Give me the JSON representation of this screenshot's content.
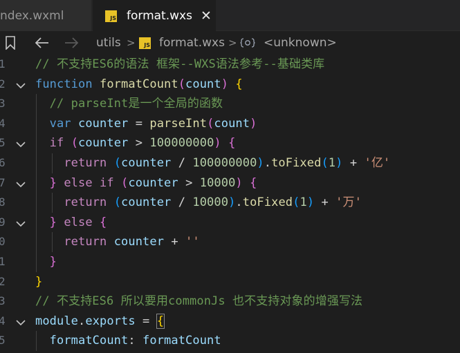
{
  "tabs": {
    "inactive_label": "ndex.wxml",
    "active_label": "format.wxs",
    "active_icon_text": "JS",
    "close_glyph": "✕"
  },
  "breadcrumb": {
    "folder": "utils",
    "separator": ">",
    "file_icon_text": "JS",
    "file": "format.wxs",
    "symbol": "<unknown>"
  },
  "icons": {
    "bookmark": "bookmark-icon",
    "back": "arrow-left-icon",
    "forward": "arrow-right-icon",
    "fold": "chevron-down-icon",
    "symbol": "symbol-namespace-icon"
  },
  "gutter": [
    "1",
    "2",
    "3",
    "4",
    "5",
    "6",
    "7",
    "8",
    "9",
    "0",
    "1",
    "2",
    "3",
    "4",
    "5"
  ],
  "code": [
    [
      [
        "// 不支持ES6的语法 框架--WXS语法参考--基础类库",
        "c-comment"
      ]
    ],
    [
      [
        "function ",
        "c-decl"
      ],
      [
        "formatCount",
        "c-fn"
      ],
      [
        "(",
        "c-br2"
      ],
      [
        "count",
        "c-var"
      ],
      [
        "(",
        "c-br2"
      ],
      [
        ") ",
        "c-br2"
      ],
      [
        "{",
        "c-br1"
      ]
    ],
    [
      [
        "  // parseInt是一个全局的函数",
        "c-comment"
      ]
    ],
    [
      [
        "  var ",
        "c-decl"
      ],
      [
        "counter ",
        "c-var"
      ],
      [
        "= ",
        "c-plain"
      ],
      [
        "parseInt",
        "c-fn"
      ],
      [
        "(",
        "c-br2"
      ],
      [
        "count",
        "c-var"
      ],
      [
        ")",
        "c-br2"
      ]
    ],
    [
      [
        "  if ",
        "c-kw"
      ],
      [
        "(",
        "c-br2"
      ],
      [
        "counter ",
        "c-var"
      ],
      [
        "> ",
        "c-plain"
      ],
      [
        "100000000",
        "c-num"
      ],
      [
        ") ",
        "c-br2"
      ],
      [
        "{",
        "c-br2"
      ]
    ],
    [
      [
        "    return ",
        "c-kw"
      ],
      [
        "(",
        "c-br3"
      ],
      [
        "counter ",
        "c-var"
      ],
      [
        "/ ",
        "c-plain"
      ],
      [
        "100000000",
        "c-num"
      ],
      [
        ")",
        "c-br3"
      ],
      [
        ".",
        "c-plain"
      ],
      [
        "toFixed",
        "c-fn"
      ],
      [
        "(",
        "c-br3"
      ],
      [
        "1",
        "c-num"
      ],
      [
        ")",
        "c-br3"
      ],
      [
        " + ",
        "c-plain"
      ],
      [
        "'亿'",
        "c-str"
      ]
    ],
    [
      [
        "  ",
        "c-plain"
      ],
      [
        "}",
        "c-br2"
      ],
      [
        " else if ",
        "c-kw"
      ],
      [
        "(",
        "c-br2"
      ],
      [
        "counter ",
        "c-var"
      ],
      [
        "> ",
        "c-plain"
      ],
      [
        "10000",
        "c-num"
      ],
      [
        ") ",
        "c-br2"
      ],
      [
        "{",
        "c-br2"
      ]
    ],
    [
      [
        "    return ",
        "c-kw"
      ],
      [
        "(",
        "c-br3"
      ],
      [
        "counter ",
        "c-var"
      ],
      [
        "/ ",
        "c-plain"
      ],
      [
        "10000",
        "c-num"
      ],
      [
        ")",
        "c-br3"
      ],
      [
        ".",
        "c-plain"
      ],
      [
        "toFixed",
        "c-fn"
      ],
      [
        "(",
        "c-br3"
      ],
      [
        "1",
        "c-num"
      ],
      [
        ")",
        "c-br3"
      ],
      [
        " + ",
        "c-plain"
      ],
      [
        "'万'",
        "c-str"
      ]
    ],
    [
      [
        "  ",
        "c-plain"
      ],
      [
        "}",
        "c-br2"
      ],
      [
        " else ",
        "c-kw"
      ],
      [
        "{",
        "c-br2"
      ]
    ],
    [
      [
        "    return ",
        "c-kw"
      ],
      [
        "counter ",
        "c-var"
      ],
      [
        "+ ",
        "c-plain"
      ],
      [
        "''",
        "c-str"
      ]
    ],
    [
      [
        "  ",
        "c-plain"
      ],
      [
        "}",
        "c-br2"
      ]
    ],
    [
      [
        "}",
        "c-br1"
      ]
    ],
    [
      [
        "// 不支持ES6 所以要用commonJs 也不支持对象的增强写法",
        "c-comment"
      ]
    ],
    [
      [
        "module",
        "c-var"
      ],
      [
        ".",
        "c-plain"
      ],
      [
        "exports ",
        "c-var"
      ],
      [
        "= ",
        "c-plain"
      ],
      [
        "{",
        "c-br1"
      ]
    ],
    [
      [
        "  ",
        "c-plain"
      ],
      [
        "formatCount",
        "c-var"
      ],
      [
        ": ",
        "c-plain"
      ],
      [
        "formatCount",
        "c-var"
      ]
    ]
  ],
  "colors": {
    "background": "#1e1e1e",
    "comment": "#6a9955",
    "keyword": "#c586c0",
    "declaration": "#569cd6",
    "function": "#dcdcaa",
    "variable": "#9cdcfe",
    "number": "#b5cea8",
    "string": "#ce9178",
    "js_badge": "#e8c227"
  }
}
